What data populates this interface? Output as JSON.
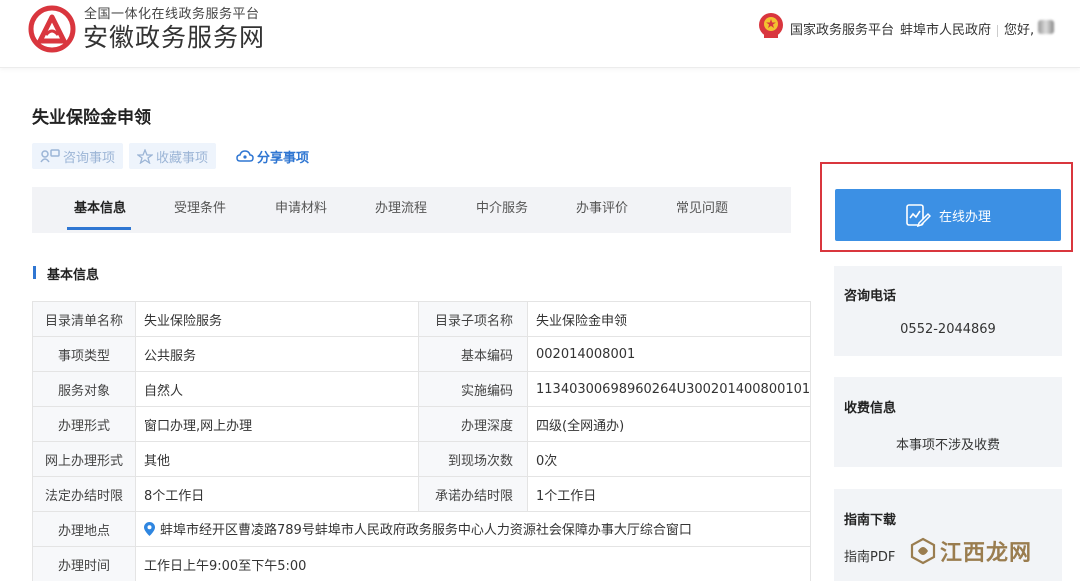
{
  "header": {
    "logo_sub": "全国一体化在线政务服务平台",
    "logo_main": "安徽政务服务网",
    "links": [
      "国家政务服务平台",
      "蚌埠市人民政府"
    ],
    "greeting": "您好,",
    "colors": {
      "brand_red": "#d9363e",
      "accent_blue": "#2f76d2"
    }
  },
  "page": {
    "title": "失业保险金申领",
    "actions": {
      "consult": "咨询事项",
      "favorite": "收藏事项",
      "share": "分享事项"
    }
  },
  "tabs": [
    "基本信息",
    "受理条件",
    "申请材料",
    "办理流程",
    "中介服务",
    "办事评价",
    "常见问题"
  ],
  "active_tab": "基本信息",
  "section": {
    "title": "基本信息"
  },
  "info": {
    "rows": [
      {
        "l1": "目录清单名称",
        "v1": "失业保险服务",
        "l2": "目录子项名称",
        "v2": "失业保险金申领"
      },
      {
        "l1": "事项类型",
        "v1": "公共服务",
        "l2": "基本编码",
        "v2": "002014008001"
      },
      {
        "l1": "服务对象",
        "v1": "自然人",
        "l2": "实施编码",
        "v2": "11340300698960264U300201400800101"
      },
      {
        "l1": "办理形式",
        "v1": "窗口办理,网上办理",
        "l2": "办理深度",
        "v2": "四级(全网通办)"
      },
      {
        "l1": "网上办理形式",
        "v1": "其他",
        "l2": "到现场次数",
        "v2": "0次"
      },
      {
        "l1": "法定办结时限",
        "v1": "8个工作日",
        "l2": "承诺办结时限",
        "v2": "1个工作日"
      }
    ],
    "address_label": "办理地点",
    "address": "蚌埠市经开区曹凌路789号蚌埠市人民政府政务服务中心人力资源社会保障办事大厅综合窗口",
    "hours_label": "办理时间",
    "hours": "工作日上午9:00至下午5:00"
  },
  "sidebar": {
    "online_button": "在线办理",
    "phone_title": "咨询电话",
    "phone": "0552-2044869",
    "fee_title": "收费信息",
    "fee": "本事项不涉及收费",
    "guide_title": "指南下载",
    "guide_pdf": "指南PDF"
  },
  "watermark": {
    "text": "江西龙网"
  }
}
